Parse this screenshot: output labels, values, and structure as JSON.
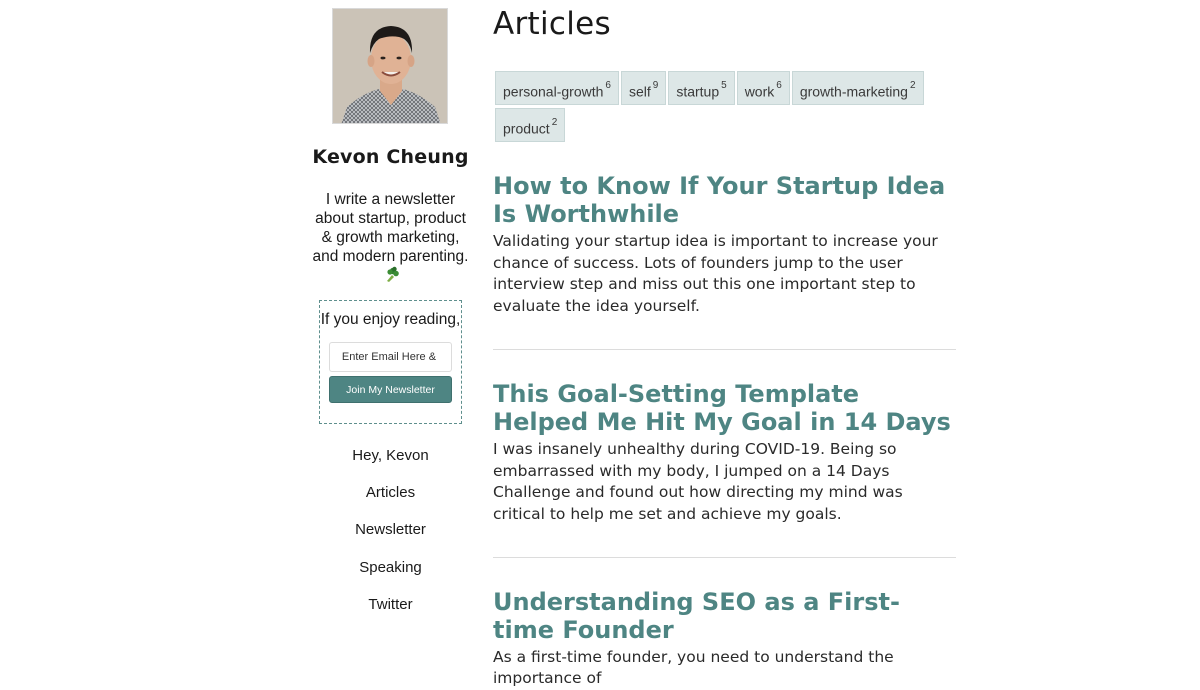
{
  "author": {
    "name": "Kevon Cheung",
    "bio": "I write a newsletter about startup, product & growth marketing, and modern parenting."
  },
  "subscribe": {
    "heading": "If you enjoy reading,",
    "placeholder": "Enter Email Here & ",
    "button_label": "Join My Newsletter"
  },
  "nav": {
    "items": [
      {
        "label": "Hey, Kevon"
      },
      {
        "label": "Articles"
      },
      {
        "label": "Newsletter"
      },
      {
        "label": "Speaking"
      },
      {
        "label": "Twitter"
      }
    ]
  },
  "page": {
    "title": "Articles"
  },
  "tags": [
    {
      "label": "personal-growth",
      "count": "6"
    },
    {
      "label": "self",
      "count": "9"
    },
    {
      "label": "startup",
      "count": "5"
    },
    {
      "label": "work",
      "count": "6"
    },
    {
      "label": "growth-marketing",
      "count": "2"
    },
    {
      "label": "product",
      "count": "2"
    }
  ],
  "articles": [
    {
      "title": "How to Know If Your Startup Idea Is Worthwhile",
      "excerpt": "Validating your startup idea is important to increase your chance of success. Lots of founders jump to the user interview step and miss out this one important step to evaluate the idea yourself."
    },
    {
      "title": "This Goal-Setting Template Helped Me Hit My Goal in 14 Days",
      "excerpt": "I was insanely unhealthy during COVID-19. Being so embarrassed with my body, I jumped on a 14 Days Challenge and found out how directing my mind was critical to help me set and achieve my goals."
    },
    {
      "title": "Understanding SEO as a First-time Founder",
      "excerpt": "As a first-time founder, you need to understand the importance of"
    }
  ],
  "colors": {
    "accent": "#4e8583",
    "tag_bg": "#dde7e7",
    "text": "#1a1a1a"
  }
}
